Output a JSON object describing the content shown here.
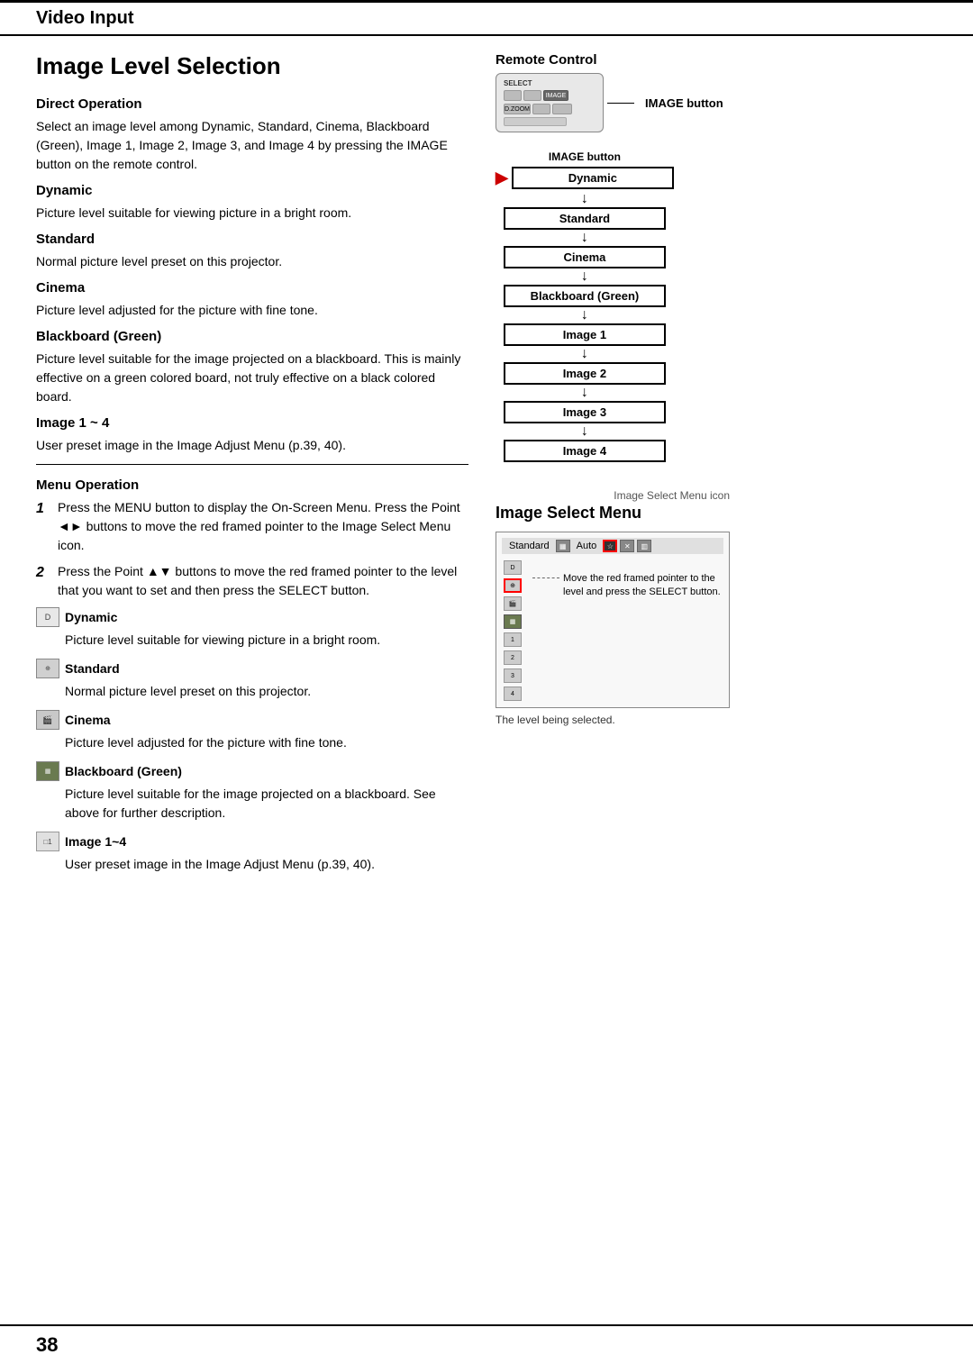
{
  "header": {
    "title": "Video Input"
  },
  "page": {
    "section_title": "Image Level Selection",
    "left": {
      "direct_operation": {
        "title": "Direct Operation",
        "body": "Select an image level among Dynamic, Standard, Cinema, Blackboard (Green), Image 1, Image 2, Image 3, and Image 4 by pressing the IMAGE button on the remote control."
      },
      "dynamic": {
        "title": "Dynamic",
        "body": "Picture level suitable for viewing picture in a bright room."
      },
      "standard": {
        "title": "Standard",
        "body": "Normal picture level preset on this projector."
      },
      "cinema": {
        "title": "Cinema",
        "body": "Picture level adjusted for the picture with fine tone."
      },
      "blackboard": {
        "title": "Blackboard (Green)",
        "body": "Picture level suitable for the image projected on a blackboard.  This is mainly effective on a green colored board, not truly effective on a black colored board."
      },
      "image14": {
        "title": "Image 1 ~ 4",
        "body": "User preset image in the Image Adjust Menu (p.39, 40)."
      },
      "menu_operation": {
        "title": "Menu Operation",
        "step1": "Press the MENU button to display the On-Screen Menu.  Press the Point ◄► buttons to move the red framed pointer to the Image Select Menu icon.",
        "step2": "Press the Point ▲▼ buttons to move the red framed pointer to the level that you want to set and then press the SELECT button."
      },
      "dynamic2": {
        "icon_label": "Dynamic",
        "body": "Picture level suitable for viewing picture in a bright room."
      },
      "standard2": {
        "icon_label": "Standard",
        "body": "Normal picture level preset on this projector."
      },
      "cinema2": {
        "icon_label": "Cinema",
        "body": "Picture level adjusted for the picture with fine tone."
      },
      "blackboard2": {
        "icon_label": "Blackboard (Green)",
        "body": "Picture level suitable for the image projected on a blackboard. See above for further description."
      },
      "image14_2": {
        "icon_label": "Image 1~4",
        "body": "User preset image in the Image Adjust Menu (p.39, 40)."
      }
    },
    "right": {
      "remote_control": {
        "title": "Remote Control",
        "image_button_label": "IMAGE button"
      },
      "flow": {
        "top_label": "IMAGE button",
        "items": [
          "Dynamic",
          "Standard",
          "Cinema",
          "Blackboard (Green)",
          "Image 1",
          "Image 2",
          "Image 3",
          "Image 4"
        ]
      },
      "image_select": {
        "title": "Image Select Menu",
        "icon_label": "Image Select Menu icon",
        "menu_bar": [
          "Standard",
          "Auto"
        ],
        "annotation": "Move the red framed pointer to the level and press the SELECT button.",
        "level_note": "The level being selected."
      }
    }
  },
  "footer": {
    "page_number": "38"
  }
}
